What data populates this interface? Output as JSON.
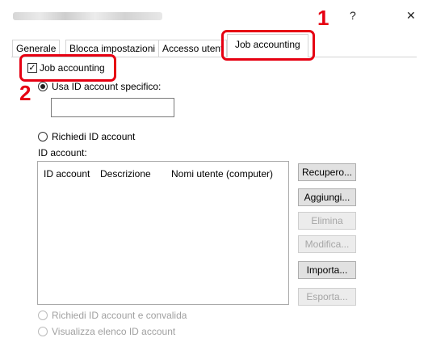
{
  "titlebar": {
    "help_label": "?",
    "close_label": "✕"
  },
  "tabs": [
    {
      "label": "Generale"
    },
    {
      "label": "Blocca impostazioni"
    },
    {
      "label": "Accesso utent"
    },
    {
      "label": "Job accounting"
    }
  ],
  "callouts": {
    "one": "1",
    "two": "2"
  },
  "job_accounting_checkbox": {
    "label": "Job accounting",
    "check": "✓"
  },
  "use_specific_id": {
    "label": "Usa ID account specifico:",
    "value": ""
  },
  "request_id": {
    "label": "Richiedi ID account"
  },
  "account_list": {
    "label": "ID account:",
    "columns": [
      "ID account",
      "Descrizione",
      "Nomi utente (computer)"
    ],
    "rows": []
  },
  "buttons": {
    "recupero": "Recupero...",
    "aggiungi": "Aggiungi...",
    "elimina": "Elimina",
    "modifica": "Modifica...",
    "importa": "Importa...",
    "esporta": "Esporta..."
  },
  "request_validate": {
    "label": "Richiedi ID account e convalida"
  },
  "show_list": {
    "label": "Visualizza elenco ID account"
  },
  "colors": {
    "callout_red": "#e60012"
  }
}
